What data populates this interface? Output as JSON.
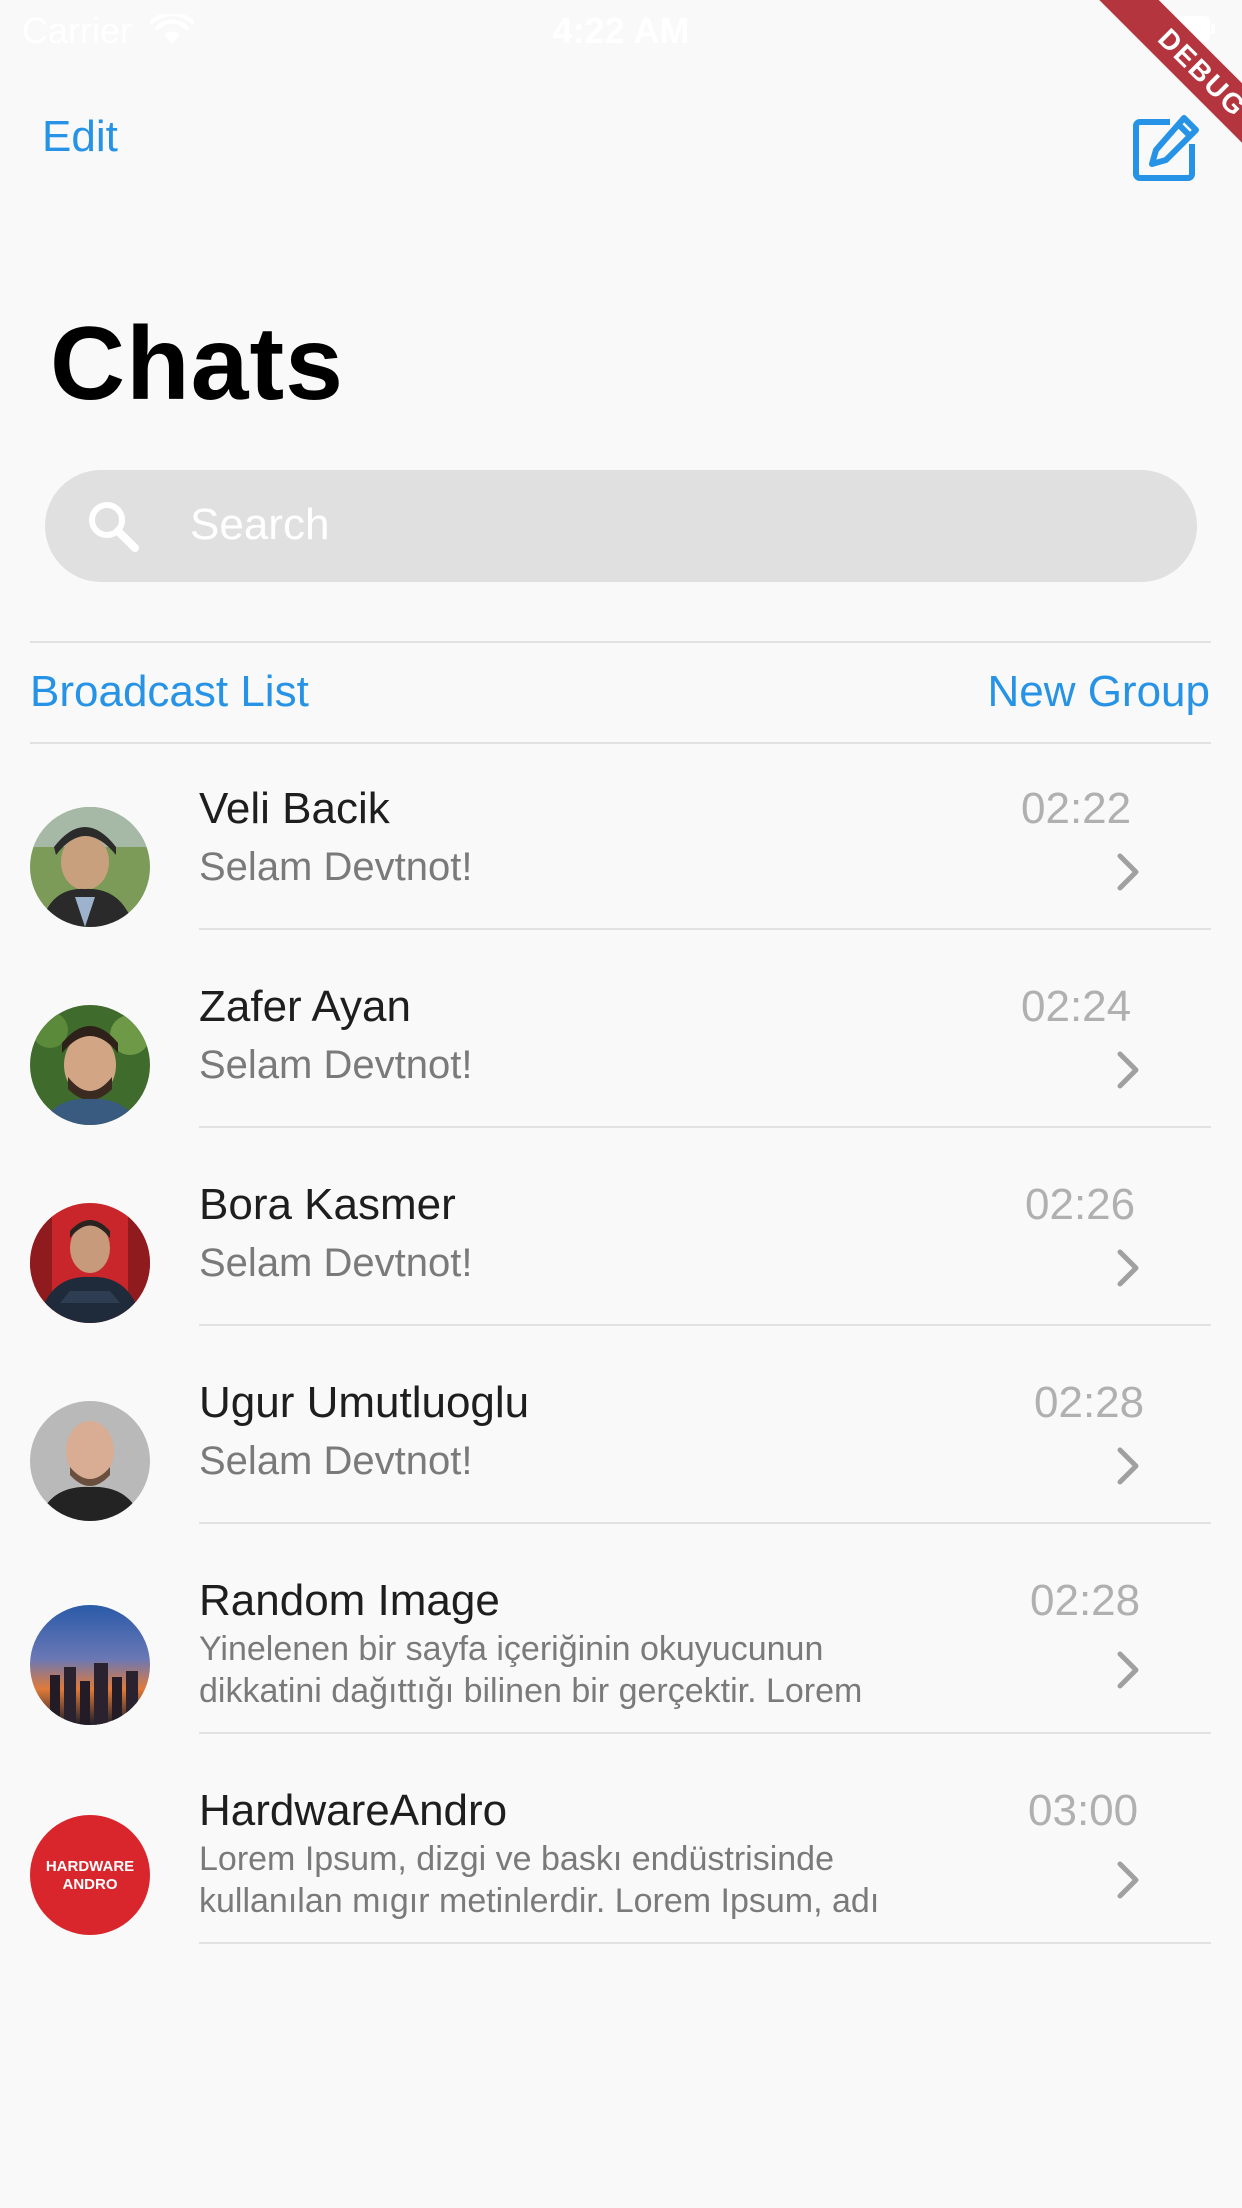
{
  "status_bar": {
    "carrier": "Carrier",
    "time": "4:22 AM"
  },
  "debug_banner": "DEBUG",
  "nav": {
    "edit_label": "Edit",
    "compose_icon": "compose-icon"
  },
  "title": "Chats",
  "search": {
    "placeholder": "Search"
  },
  "actions": {
    "broadcast": "Broadcast List",
    "new_group": "New Group"
  },
  "colors": {
    "accent": "#2693e6",
    "debug": "#b4353e"
  },
  "chats": [
    {
      "name": "Veli Bacik",
      "message": "Selam Devtnot!",
      "time": "02:22"
    },
    {
      "name": "Zafer Ayan",
      "message": "Selam Devtnot!",
      "time": "02:24"
    },
    {
      "name": "Bora Kasmer",
      "message": "Selam Devtnot!",
      "time": "02:26"
    },
    {
      "name": "Ugur Umutluoglu",
      "message": "Selam Devtnot!",
      "time": "02:28"
    },
    {
      "name": "Random Image",
      "message_lines": [
        "Yinelenen bir sayfa içeriğinin okuyucunun",
        "dikkatini dağıttığı bilinen bir gerçektir. Lorem"
      ],
      "time": "02:28"
    },
    {
      "name": "HardwareAndro",
      "message_lines": [
        "Lorem Ipsum, dizgi ve baskı endüstrisinde",
        "kullanılan mıgır metinlerdir. Lorem Ipsum, adı"
      ],
      "time": "03:00",
      "avatar_text": "HARDWARE ANDRO"
    }
  ]
}
